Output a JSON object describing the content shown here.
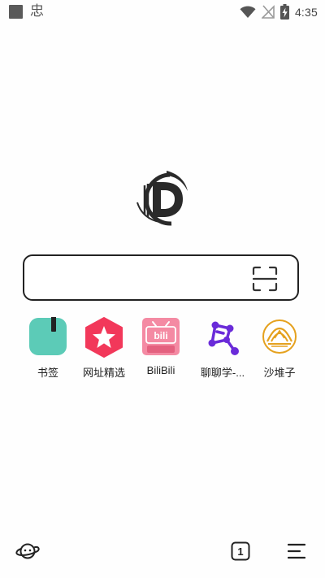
{
  "status_bar": {
    "app_glyph": "忠",
    "time": "4:35",
    "icons": [
      "notification-square-icon",
      "wifi-icon",
      "no-signal-icon",
      "battery-charging-icon"
    ]
  },
  "logo": {
    "icon": "browser-d-logo",
    "color": "#2a2a2a"
  },
  "search": {
    "value": "",
    "placeholder": "",
    "scan_icon": "scan-icon"
  },
  "shortcuts": [
    {
      "label": "书签",
      "icon": "bookmark-icon",
      "color": "#5ccbb7"
    },
    {
      "label": "网址精选",
      "icon": "star-hexagon-icon",
      "color": "#f2385a"
    },
    {
      "label": "BiliBili",
      "icon": "bilibili-icon",
      "color": "#f48aa3"
    },
    {
      "label": "聊聊学-...",
      "icon": "graph-nodes-icon",
      "color": "#6a2bd9"
    },
    {
      "label": "沙堆子",
      "icon": "dune-icon",
      "color": "#e5a11e"
    }
  ],
  "bottom_bar": {
    "tab_count": "1",
    "items": [
      "planet-icon",
      "tabs-icon",
      "menu-icon"
    ]
  }
}
